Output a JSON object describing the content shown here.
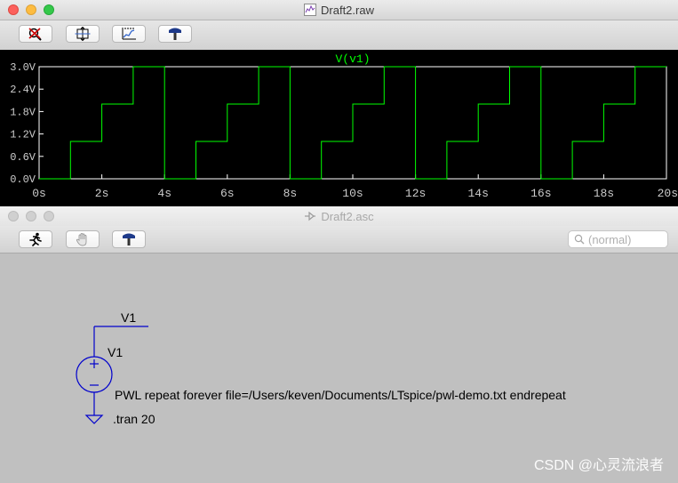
{
  "waveform_window": {
    "title": "Draft2.raw",
    "toolbar": {
      "buttons": [
        {
          "icon": "zoom-cancel-icon"
        },
        {
          "icon": "autorange-icon"
        },
        {
          "icon": "zoom-full-icon"
        },
        {
          "icon": "hammer-icon"
        }
      ]
    }
  },
  "chart_data": {
    "type": "line",
    "title": "V(v1)",
    "xlabel": "",
    "ylabel": "",
    "xlim": [
      0,
      20
    ],
    "ylim": [
      0,
      3.0
    ],
    "x_ticks": [
      "0s",
      "2s",
      "4s",
      "6s",
      "8s",
      "10s",
      "12s",
      "14s",
      "16s",
      "18s",
      "20s"
    ],
    "y_ticks": [
      "0.0V",
      "0.6V",
      "1.2V",
      "1.8V",
      "2.4V",
      "3.0V"
    ],
    "series": [
      {
        "name": "V(v1)",
        "color": "#00ff00",
        "x": [
          0,
          1,
          1,
          2,
          2,
          3,
          3,
          4,
          4,
          5,
          5,
          6,
          6,
          7,
          7,
          8,
          8,
          9,
          9,
          10,
          10,
          11,
          11,
          12,
          12,
          13,
          13,
          14,
          14,
          15,
          15,
          16,
          16,
          17,
          17,
          18,
          18,
          19,
          19,
          20
        ],
        "y": [
          0,
          0,
          1,
          1,
          2,
          2,
          3,
          3,
          0,
          0,
          1,
          1,
          2,
          2,
          3,
          3,
          0,
          0,
          1,
          1,
          2,
          2,
          3,
          3,
          0,
          0,
          1,
          1,
          2,
          2,
          3,
          3,
          0,
          0,
          1,
          1,
          2,
          2,
          3,
          3
        ]
      }
    ]
  },
  "schematic_window": {
    "title": "Draft2.asc",
    "toolbar": {
      "buttons": [
        {
          "icon": "run-icon"
        },
        {
          "icon": "hand-icon"
        },
        {
          "icon": "hammer-icon"
        }
      ],
      "search_placeholder": "(normal)"
    },
    "labels": {
      "net_label": "V1",
      "component_name": "V1",
      "pwl_directive": "PWL repeat forever file=/Users/keven/Documents/LTspice/pwl-demo.txt endrepeat",
      "tran_directive": ".tran 20"
    },
    "component_color": "#0000cc",
    "watermark": "CSDN @心灵流浪者"
  }
}
